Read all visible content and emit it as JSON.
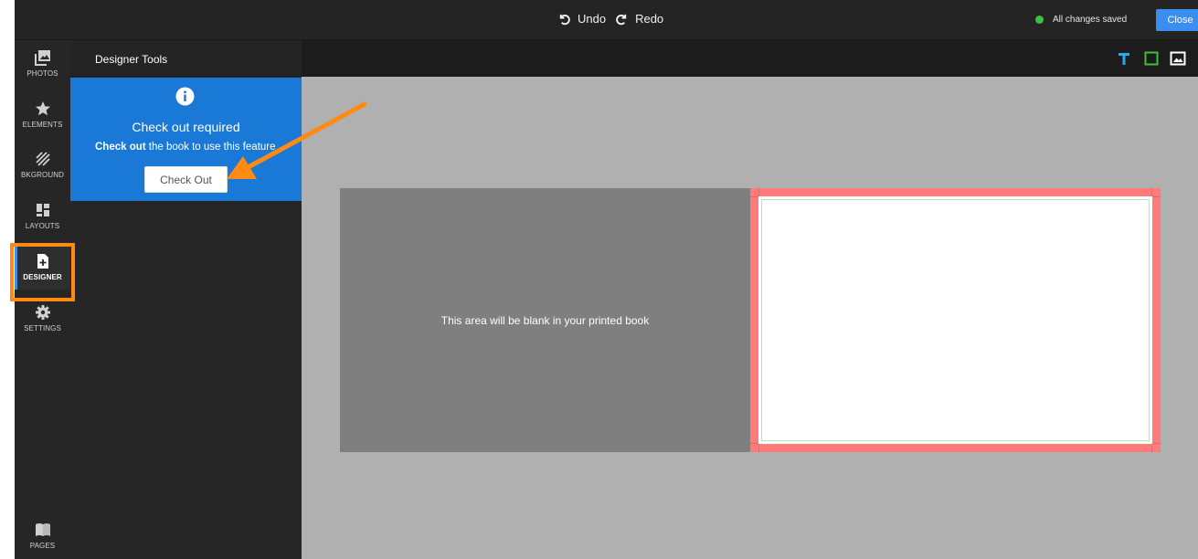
{
  "topbar": {
    "undo_label": "Undo",
    "redo_label": "Redo",
    "save_status": "All changes saved",
    "close_label": "Close"
  },
  "sidebar": {
    "items": [
      {
        "label": "PHOTOS",
        "icon": "photos-icon"
      },
      {
        "label": "ELEMENTS",
        "icon": "star-icon"
      },
      {
        "label": "BKGROUND",
        "icon": "background-pattern-icon"
      },
      {
        "label": "LAYOUTS",
        "icon": "layouts-icon"
      },
      {
        "label": "DESIGNER",
        "icon": "designer-file-icon",
        "active": true
      },
      {
        "label": "SETTINGS",
        "icon": "gear-icon"
      },
      {
        "label": "PAGES",
        "icon": "book-icon"
      }
    ]
  },
  "panel": {
    "title": "Designer Tools",
    "notice": {
      "title": "Check out required",
      "message_bold": "Check out",
      "message_rest": " the book to use this feature",
      "button_label": "Check Out"
    }
  },
  "canvas": {
    "tools": [
      "text-tool-icon",
      "shape-tool-icon",
      "image-tool-icon"
    ],
    "blank_page_text": "This area will be blank in your printed book"
  },
  "colors": {
    "accent": "#3a8ef0",
    "notice_bg": "#1a78d6",
    "highlight": "#ff8a14",
    "bleed": "#ff7b7b",
    "saved_dot": "#3fbf3f",
    "text_tool": "#2ea7f2",
    "shape_tool": "#3fbf3f"
  }
}
